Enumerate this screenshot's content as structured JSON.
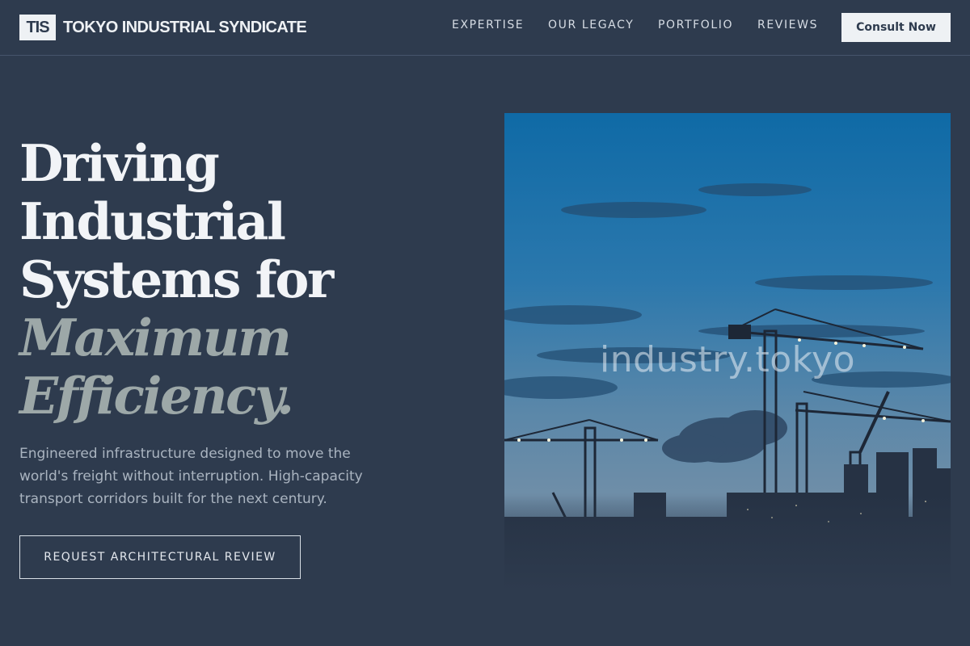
{
  "brand": {
    "mark": "TIS",
    "name": "TOKYO INDUSTRIAL SYNDICATE"
  },
  "nav": {
    "items": [
      {
        "label": "EXPERTISE"
      },
      {
        "label": "OUR LEGACY"
      },
      {
        "label": "PORTFOLIO"
      },
      {
        "label": "REVIEWS"
      }
    ],
    "cta_label": "Consult Now"
  },
  "hero": {
    "headline_lines": [
      "Driving",
      "Industrial",
      "Systems for"
    ],
    "headline_accent_lines": [
      "Maximum",
      "Efficiency."
    ],
    "lede": "Engineered infrastructure designed to move the world's freight without interruption. High-capacity transport corridors built for the next century.",
    "button_label": "REQUEST ARCHITECTURAL REVIEW",
    "image": {
      "subject": "construction cranes silhouetted against a blue dusk sky",
      "watermark": "industry.tokyo"
    }
  },
  "colors": {
    "background": "#2e3b4e",
    "accent_text": "#9da8a8",
    "light": "#eef1f4"
  }
}
